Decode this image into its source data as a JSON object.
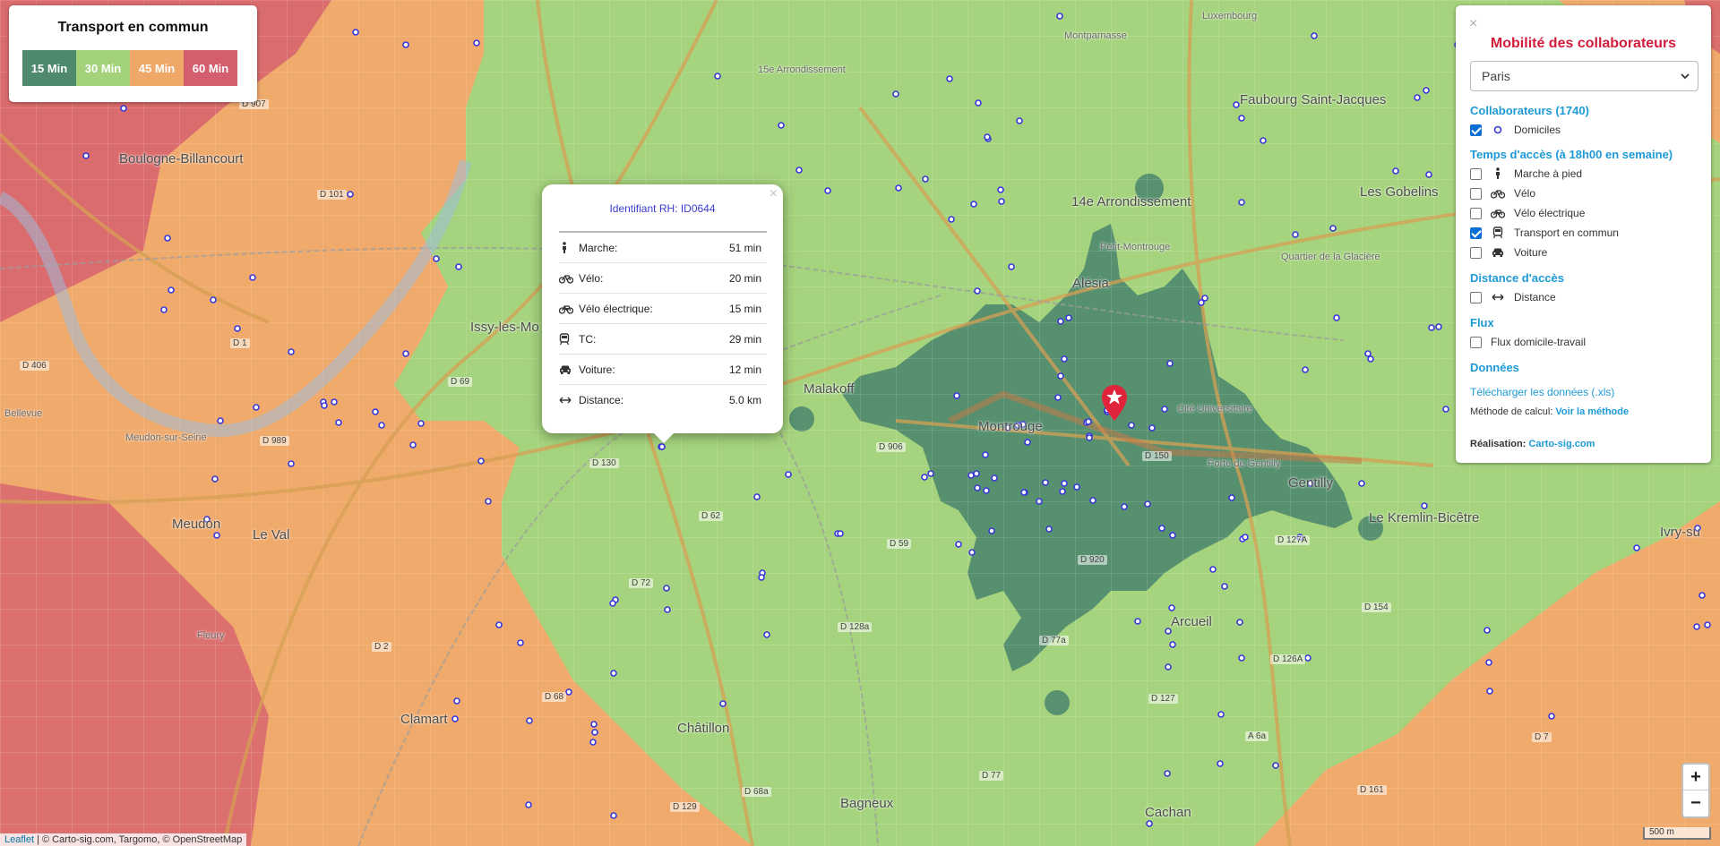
{
  "legend": {
    "title": "Transport en commun",
    "items": [
      {
        "label": "15 Min",
        "color": "#4f8a6e"
      },
      {
        "label": "30 Min",
        "color": "#a3d27b"
      },
      {
        "label": "45 Min",
        "color": "#f0a868"
      },
      {
        "label": "60 Min",
        "color": "#d45d6e"
      }
    ]
  },
  "popup": {
    "close": "×",
    "title": "Identifiant RH: ID0644",
    "rows": [
      {
        "icon": "walk-icon",
        "label": "Marche:",
        "value": "51 min"
      },
      {
        "icon": "bike-icon",
        "label": "Vélo:",
        "value": "20 min"
      },
      {
        "icon": "ebike-icon",
        "label": "Vélo électrique:",
        "value": "15 min"
      },
      {
        "icon": "train-icon",
        "label": "TC:",
        "value": "29 min"
      },
      {
        "icon": "car-icon",
        "label": "Voiture:",
        "value": "12 min"
      },
      {
        "icon": "distance-icon",
        "label": "Distance:",
        "value": "5.0 km"
      }
    ]
  },
  "panel": {
    "close": "×",
    "title": "Mobilité des collaborateurs",
    "city_select": "Paris",
    "collab_header": "Collaborateurs (1740)",
    "domiciles_label": "Domiciles",
    "access_header": "Temps d'accès (à 18h00 en semaine)",
    "modes": [
      {
        "label": "Marche à pied",
        "icon": "walk-icon",
        "checked": false
      },
      {
        "label": "Vélo",
        "icon": "bike-icon",
        "checked": false
      },
      {
        "label": "Vélo électrique",
        "icon": "ebike-icon",
        "checked": false
      },
      {
        "label": "Transport en commun",
        "icon": "train-icon",
        "checked": true
      },
      {
        "label": "Voiture",
        "icon": "car-icon",
        "checked": false
      }
    ],
    "distance_header": "Distance d'accès",
    "distance_label": "Distance",
    "flux_header": "Flux",
    "flux_label": "Flux domicile-travail",
    "data_header": "Données",
    "download_link": "Télécharger les données (.xls)",
    "method_prefix": "Méthode de calcul:",
    "method_link": "Voir la méthode",
    "credit_prefix": "Réalisation:",
    "credit_link": "Carto-sig.com"
  },
  "map": {
    "places": [
      {
        "name": "Boulogne-Billancourt",
        "size": "big"
      },
      {
        "name": "Issy-les-Mo",
        "size": "big"
      },
      {
        "name": "Malakoff",
        "size": "big"
      },
      {
        "name": "Montrouge",
        "size": "big"
      },
      {
        "name": "Gentilly",
        "size": "big"
      },
      {
        "name": "Le Kremlin-Bicêtre",
        "size": "big"
      },
      {
        "name": "Meudon",
        "size": "big"
      },
      {
        "name": "Meudon-sur-Seine",
        "size": "small"
      },
      {
        "name": "Le Val",
        "size": "big"
      },
      {
        "name": "Clamart",
        "size": "big"
      },
      {
        "name": "Châtillon",
        "size": "big"
      },
      {
        "name": "Bagneux",
        "size": "big"
      },
      {
        "name": "Arcueil",
        "size": "big"
      },
      {
        "name": "Cachan",
        "size": "big"
      },
      {
        "name": "Alésia",
        "size": "big"
      },
      {
        "name": "Petit-Montrouge",
        "size": "small"
      },
      {
        "name": "14e Arrondissement",
        "size": "big"
      },
      {
        "name": "15e Arrondissement",
        "size": "small"
      },
      {
        "name": "Montparnasse",
        "size": "small"
      },
      {
        "name": "Faubourg Saint-Jacques",
        "size": "big"
      },
      {
        "name": "Quartier de la Glacière",
        "size": "small"
      },
      {
        "name": "Les Gobelins",
        "size": "big"
      },
      {
        "name": "Ivry-su",
        "size": "big"
      },
      {
        "name": "Bellevue",
        "size": "small"
      },
      {
        "name": "Fleury",
        "size": "small"
      },
      {
        "name": "Luxembourg",
        "size": "small"
      },
      {
        "name": "Cité Universitaire",
        "size": "small"
      },
      {
        "name": "Porte de Gentilly",
        "size": "small"
      }
    ],
    "roads": [
      "D 906",
      "D 150",
      "D 920",
      "D 77a",
      "D 62",
      "D 59",
      "D 130",
      "D 72",
      "D 128a",
      "D 68",
      "D 2",
      "D 406",
      "D 989",
      "D 69",
      "D 1",
      "D 101",
      "D 907",
      "D 127A",
      "D 126A",
      "D 154",
      "D 127",
      "D 161",
      "D 7",
      "A 6a",
      "D 129",
      "D 68a",
      "D 77"
    ],
    "scale": "500 m",
    "attribution_leaflet": "Leaflet",
    "attribution_rest": " | © Carto-sig.com, Targomo, © OpenStreetMap",
    "zoom_in": "+",
    "zoom_out": "−"
  }
}
